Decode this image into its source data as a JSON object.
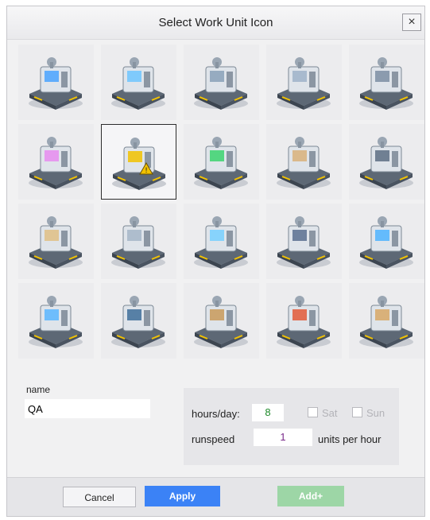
{
  "dialog": {
    "title": "Select Work Unit Icon",
    "close_label": "×"
  },
  "icons": [
    {
      "name": "laser-cutter-icon",
      "accent": "#4aa3ff"
    },
    {
      "name": "cnc-machine-icon",
      "accent": "#6ec6ff"
    },
    {
      "name": "gantry-robot-icon",
      "accent": "#8aa1b8"
    },
    {
      "name": "robot-arm-icon",
      "accent": "#9fb3c9"
    },
    {
      "name": "tank-reactor-icon",
      "accent": "#7d8ea3"
    },
    {
      "name": "welding-robot-icon",
      "accent": "#e78cf0"
    },
    {
      "name": "warning-machine-icon",
      "accent": "#f2c200"
    },
    {
      "name": "sewing-machine-icon",
      "accent": "#3cd46e"
    },
    {
      "name": "conveyor-box-icon",
      "accent": "#d9b27a"
    },
    {
      "name": "hydraulic-press-icon",
      "accent": "#5d6f84"
    },
    {
      "name": "mixer-silo-icon",
      "accent": "#e0c085"
    },
    {
      "name": "roller-machine-icon",
      "accent": "#a6b6c8"
    },
    {
      "name": "vending-cabinet-icon",
      "accent": "#78d0ff"
    },
    {
      "name": "workers-team-icon",
      "accent": "#5a7090"
    },
    {
      "name": "3d-printer-icon",
      "accent": "#4fb4ff"
    },
    {
      "name": "workstation-icon",
      "accent": "#5bb6ff"
    },
    {
      "name": "control-panel-icon",
      "accent": "#3f6f9a"
    },
    {
      "name": "pallet-wrapper-icon",
      "accent": "#c99a5a"
    },
    {
      "name": "gas-cutter-icon",
      "accent": "#e35a3a"
    },
    {
      "name": "palletizer-robot-icon",
      "accent": "#d8a866"
    }
  ],
  "selected_index": 6,
  "form": {
    "name_label": "name",
    "name_value": "QA",
    "hours_label": "hours/day:",
    "hours_value": "8",
    "sat_label": "Sat",
    "sun_label": "Sun",
    "runspeed_label": "runspeed",
    "runspeed_value": "1",
    "units_label": "units per hour"
  },
  "footer": {
    "cancel_label": "Cancel",
    "apply_label": "Apply",
    "add_label": "Add+"
  },
  "colors": {
    "apply": "#3b82f6",
    "add_disabled": "#9dd6a6",
    "hours_value": "#1e8a2a",
    "runspeed_value": "#7a2a8a"
  }
}
